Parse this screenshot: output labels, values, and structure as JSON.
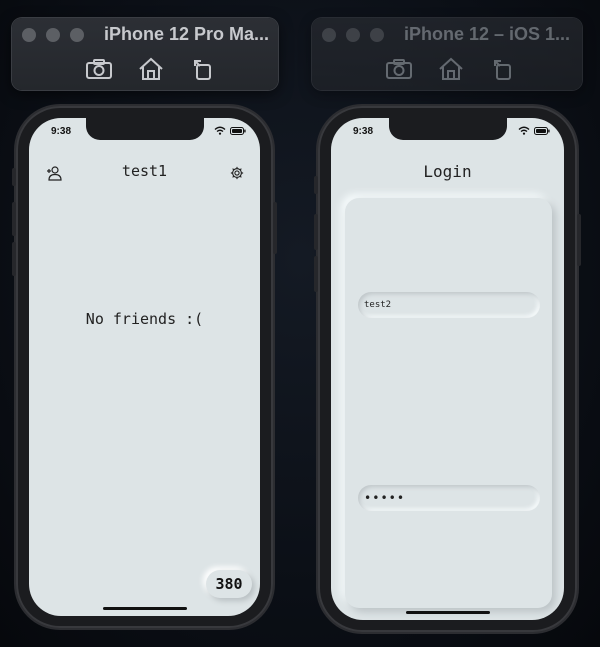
{
  "simulators": {
    "left": {
      "title": "iPhone 12 Pro Ma..."
    },
    "right": {
      "title": "iPhone 12 – iOS 1..."
    }
  },
  "toolbar_icons": [
    "screenshot-icon",
    "home-icon",
    "rotate-icon"
  ],
  "phone1": {
    "time": "9:38",
    "nav_title": "test1",
    "empty_message": "No friends :(",
    "badge_count": "380"
  },
  "phone2": {
    "time": "9:38",
    "title": "Login",
    "username_value": "test2",
    "password_value": "•••••"
  },
  "colors": {
    "screen_bg": "#dde4e6",
    "frame": "#1b1c1f",
    "titlebar": "#2c2f35"
  }
}
